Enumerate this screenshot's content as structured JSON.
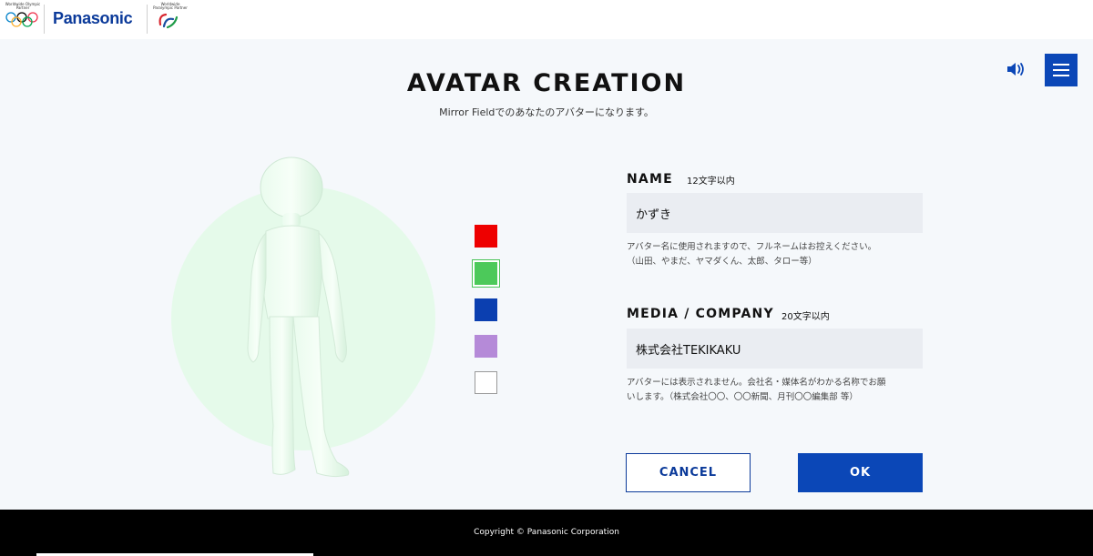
{
  "header": {
    "olympic_text": "Worldwide Olympic Partner",
    "brand": "Panasonic",
    "paralympic_text": "Worldwide Paralympic Partner"
  },
  "page": {
    "title": "AVATAR CREATION",
    "subtitle": "Mirror Fieldでのあなたのアバターになります。"
  },
  "controls": {
    "sound_icon": "speaker-icon",
    "menu_icon": "hamburger-icon"
  },
  "colors": {
    "accent": "#0b47b7",
    "circle_bg": "#e5faea",
    "swatches": [
      "#ee0000",
      "#4cc95a",
      "#0b3fb0",
      "#b58ad8",
      "#ffffff"
    ],
    "selected_swatch_index": 1
  },
  "form": {
    "name": {
      "label": "NAME",
      "limit": "12文字以内",
      "value": "かずき",
      "note_line1": "アバター名に使用されますので、フルネームはお控えください。",
      "note_line2": "（山田、やまだ、ヤマダくん、太郎、タロー等）"
    },
    "company": {
      "label": "MEDIA / COMPANY",
      "limit": "20文字以内",
      "value": "株式会社TEKIKAKU",
      "note_line1": "アバターには表示されません。会社名・媒体名がわかる名称でお願",
      "note_line2": "いします。（株式会社〇〇、〇〇新聞、月刊〇〇編集部 等）"
    }
  },
  "buttons": {
    "cancel": "CANCEL",
    "ok": "OK"
  },
  "footer": {
    "copyright": "Copyright © Panasonic Corporation"
  }
}
